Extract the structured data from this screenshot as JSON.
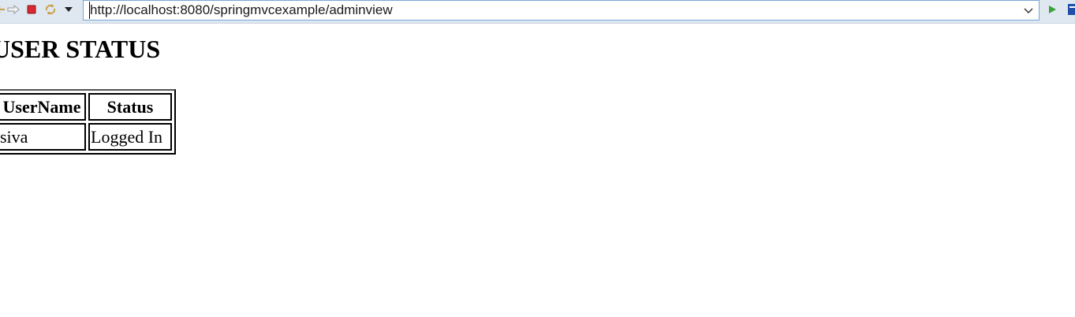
{
  "browser": {
    "url": "http://localhost:8080/springmvcexample/adminview",
    "icons": {
      "back": "back-arrow-icon",
      "forward": "forward-arrow-icon",
      "stop": "stop-icon",
      "refresh": "refresh-icon",
      "menu": "chevron-down-icon",
      "url_dropdown": "chevron-down-icon",
      "go": "play-icon"
    },
    "colors": {
      "toolbar": "#dfe7f1",
      "stop": "#d9282f",
      "go": "#3aa33a"
    }
  },
  "page": {
    "title": "USER STATUS",
    "table": {
      "headers": [
        "UserName",
        "Status"
      ],
      "rows": [
        [
          "siva",
          "Logged In"
        ]
      ]
    }
  }
}
